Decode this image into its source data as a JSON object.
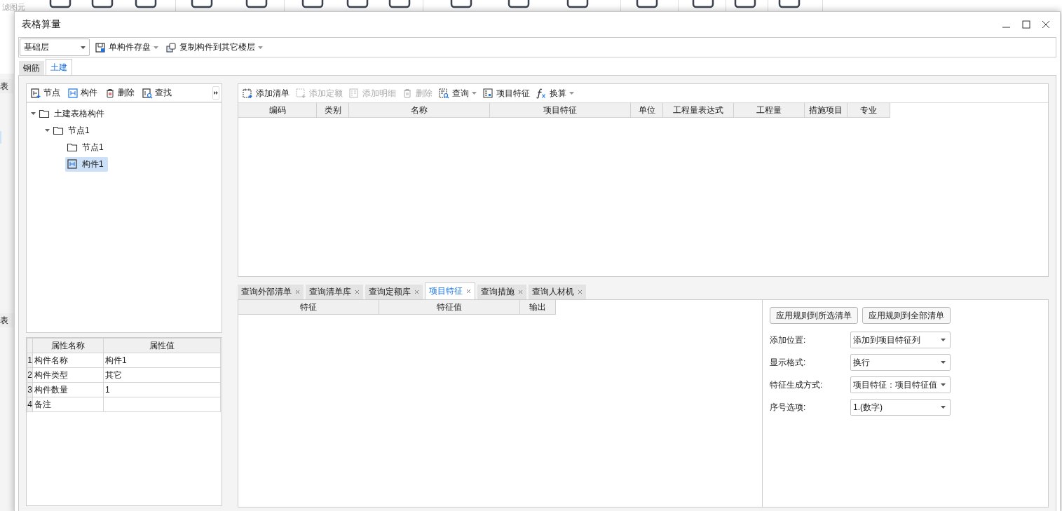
{
  "background_app": {
    "filter_label": "滤图元",
    "side_labels": [
      "表",
      "表"
    ]
  },
  "window": {
    "title": "表格算量"
  },
  "toolbar": {
    "floor_select": "基础层",
    "buttons": [
      {
        "label": "单构件存盘",
        "kind": "save",
        "dropdown": true
      },
      {
        "label": "复制构件到其它楼层",
        "kind": "copy",
        "dropdown": true
      }
    ]
  },
  "tabs": [
    {
      "label": "钢筋",
      "selected": false
    },
    {
      "label": "土建",
      "selected": true
    }
  ],
  "tree_toolbar": [
    {
      "label": "节点",
      "kind": "add-node"
    },
    {
      "label": "构件",
      "kind": "component"
    },
    {
      "label": "删除",
      "kind": "delete"
    },
    {
      "label": "查找",
      "kind": "find"
    }
  ],
  "tree": [
    {
      "label": "土建表格构件",
      "kind": "folder",
      "expanded": true,
      "selected": false,
      "children": [
        {
          "label": "节点1",
          "kind": "folder",
          "expanded": true,
          "selected": false,
          "children": [
            {
              "label": "节点1",
              "kind": "folder",
              "selected": false
            },
            {
              "label": "构件1",
              "kind": "component",
              "selected": true
            }
          ]
        }
      ]
    }
  ],
  "properties": {
    "columns": [
      "属性名称",
      "属性值"
    ],
    "rows": [
      {
        "index": "1",
        "name": "构件名称",
        "value": "构件1"
      },
      {
        "index": "2",
        "name": "构件类型",
        "value": "其它"
      },
      {
        "index": "3",
        "name": "构件数量",
        "value": "1"
      },
      {
        "index": "4",
        "name": "备注"
      }
    ]
  },
  "list_toolbar": [
    {
      "label": "添加清单",
      "kind": "add-list",
      "disabled": false,
      "dropdown": false
    },
    {
      "label": "添加定额",
      "kind": "add-quota",
      "disabled": true,
      "dropdown": false
    },
    {
      "label": "添加明细",
      "kind": "add-detail",
      "disabled": true,
      "dropdown": false
    },
    {
      "label": "删除",
      "kind": "delete",
      "disabled": true,
      "dropdown": false
    },
    {
      "label": "查询",
      "kind": "query",
      "disabled": false,
      "dropdown": true
    },
    {
      "label": "项目特征",
      "kind": "feature",
      "disabled": false,
      "dropdown": false
    },
    {
      "label": "换算",
      "kind": "formula",
      "disabled": false,
      "dropdown": true
    }
  ],
  "list_table": {
    "columns": [
      "编码",
      "类别",
      "名称",
      "项目特征",
      "单位",
      "工程量表达式",
      "工程量",
      "措施项目",
      "专业"
    ]
  },
  "bottom_tabs": [
    {
      "label": "查询外部清单",
      "selected": false
    },
    {
      "label": "查询清单库",
      "selected": false
    },
    {
      "label": "查询定额库",
      "selected": false
    },
    {
      "label": "项目特征",
      "selected": true
    },
    {
      "label": "查询措施",
      "selected": false
    },
    {
      "label": "查询人材机",
      "selected": false
    }
  ],
  "feature_table": {
    "columns": [
      "特征",
      "特征值",
      "输出"
    ]
  },
  "rule_buttons": [
    "应用规则到所选清单",
    "应用规则到全部清单"
  ],
  "options": [
    {
      "label": "添加位置:",
      "value": "添加到项目特征列"
    },
    {
      "label": "显示格式:",
      "value": "换行"
    },
    {
      "label": "特征生成方式:",
      "value": "项目特征：项目特征值"
    },
    {
      "label": "序号选项:",
      "value": "1.(数字)"
    }
  ]
}
